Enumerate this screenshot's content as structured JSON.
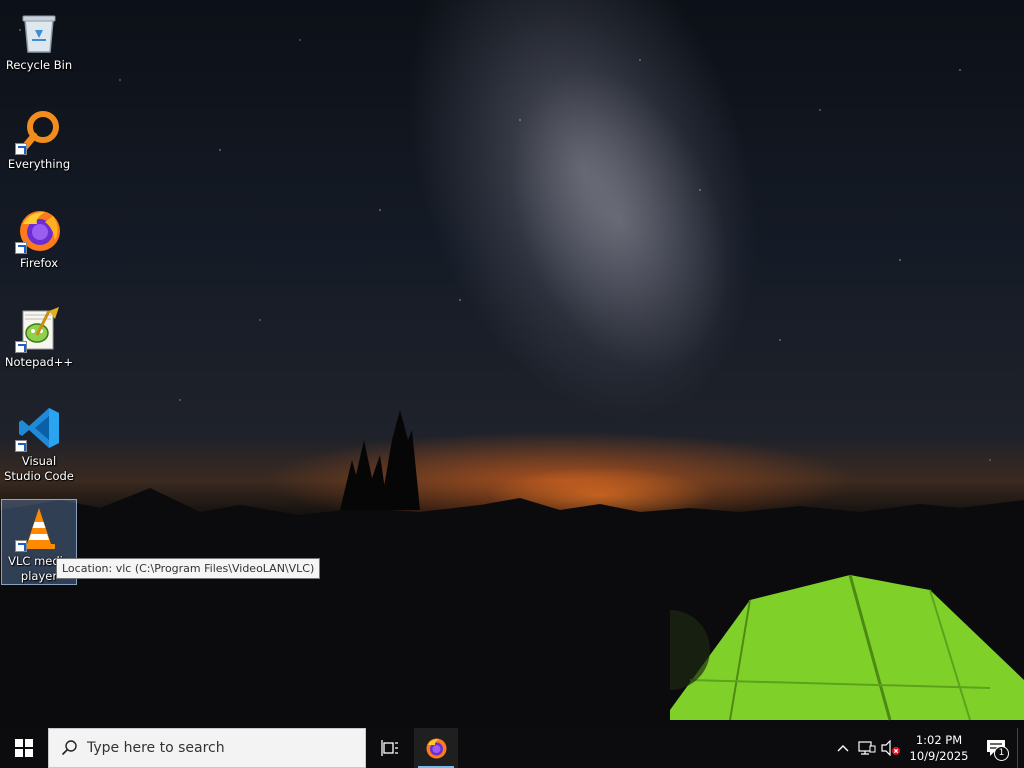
{
  "desktop": {
    "icons": [
      {
        "label": "Recycle Bin",
        "icon": "recycle-bin-icon",
        "shortcut": false,
        "selected": false
      },
      {
        "label": "Everything",
        "icon": "everything-search-icon",
        "shortcut": true,
        "selected": false
      },
      {
        "label": "Firefox",
        "icon": "firefox-icon",
        "shortcut": true,
        "selected": false
      },
      {
        "label": "Notepad++",
        "icon": "notepad-plus-plus-icon",
        "shortcut": true,
        "selected": false
      },
      {
        "label": "Visual Studio Code",
        "icon": "vscode-icon",
        "shortcut": true,
        "selected": false
      },
      {
        "label": "VLC media player",
        "icon": "vlc-cone-icon",
        "shortcut": true,
        "selected": true
      }
    ],
    "tooltip": "Location: vlc (C:\\Program Files\\VideoLAN\\VLC)"
  },
  "taskbar": {
    "search_placeholder": "Type here to search",
    "pinned_apps": [
      {
        "name": "Firefox",
        "icon": "firefox-icon",
        "active": true
      }
    ],
    "tray": {
      "icons": [
        "chevron-up-icon",
        "network-icon",
        "volume-muted-icon"
      ],
      "time": "1:02 PM",
      "date": "10/9/2025",
      "notification_count": "1"
    }
  },
  "colors": {
    "taskbar_bg": "#0c0c0e",
    "search_bg": "#f3f3f3",
    "accent": "#76b9ed",
    "windows_logo": "#ffffff"
  }
}
